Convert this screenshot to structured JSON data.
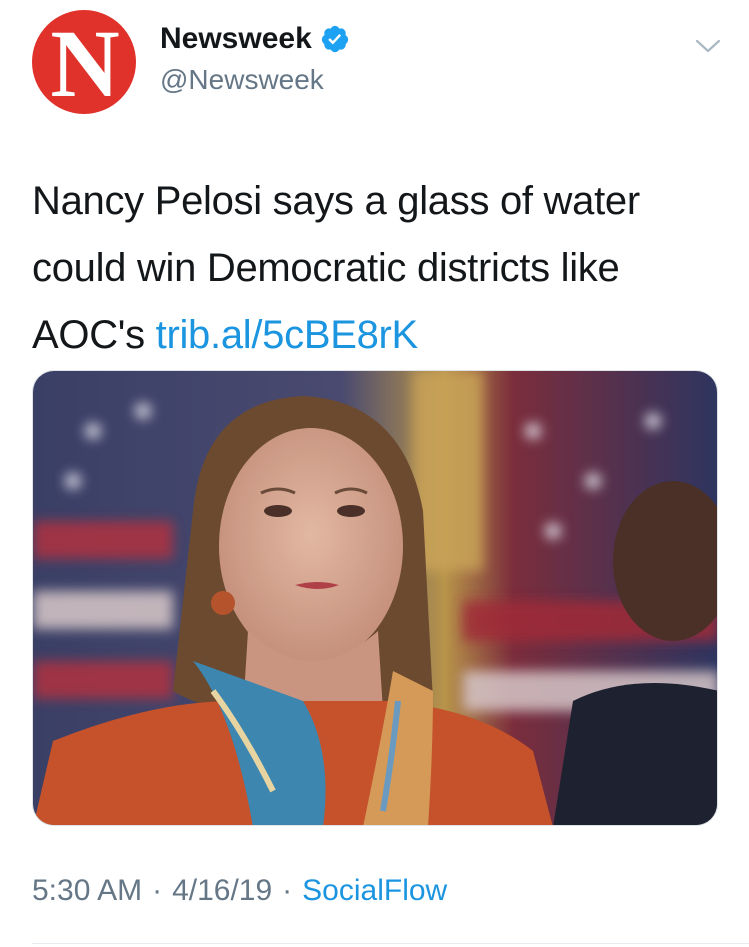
{
  "account": {
    "avatar_letter": "N",
    "display_name": "Newsweek",
    "handle": "@Newsweek",
    "verified": true,
    "avatar_color": "#e0322a",
    "verified_color": "#1da1f2"
  },
  "menu": {
    "icon": "chevron-down-icon"
  },
  "tweet": {
    "text": "Nancy Pelosi says a glass of water could win Democratic districts like AOC's ",
    "link_text": "trib.al/5cBE8rK",
    "link_color": "#1b95e0"
  },
  "meta": {
    "time": "5:30 AM",
    "separator": "·",
    "date": "4/16/19",
    "source": "SocialFlow"
  }
}
